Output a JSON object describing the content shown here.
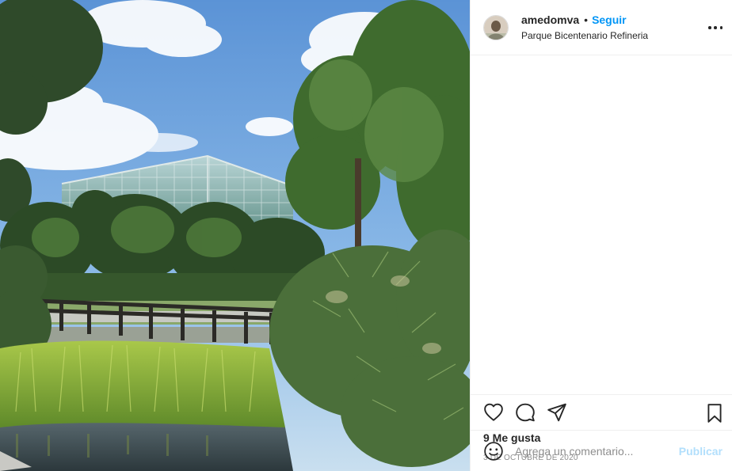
{
  "post": {
    "image": {
      "alt": "",
      "colors": {
        "sky": "#6ea3dd",
        "greenhouse": "#9fc4c7",
        "foliage_dark": "#2f4a2a",
        "grass": "#9bbf3c",
        "water": "#3d4d55"
      }
    },
    "header": {
      "username": "amedomva",
      "separator": "•",
      "follow_label": "Seguir",
      "location": "Parque Bicentenario Refineria",
      "avatar_icon": "user-avatar",
      "more_icon": "more-options-icon"
    },
    "actions": {
      "like_icon": "heart-icon",
      "comment_icon": "comment-icon",
      "share_icon": "share-icon",
      "save_icon": "bookmark-icon"
    },
    "likes_text": "9 Me gusta",
    "date_text": "3 DE OCTUBRE DE 2020",
    "comment": {
      "placeholder": "Agrega un comentario...",
      "publish_label": "Publicar",
      "emoji_icon": "emoji-icon"
    },
    "colors": {
      "accent": "#0095f6",
      "publish_disabled": "#b2dffc",
      "divider": "#efefef",
      "secondary_text": "#8e8e8e"
    }
  }
}
